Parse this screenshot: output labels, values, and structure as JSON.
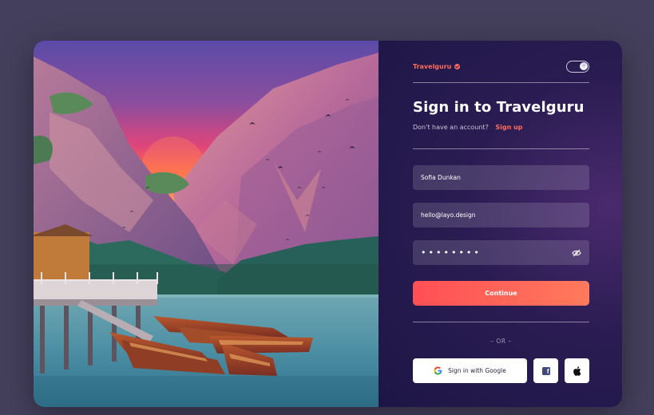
{
  "brand": {
    "name": "Travelguru",
    "badge_icon": "verified-badge-icon",
    "color": "#ff6b5a"
  },
  "theme_toggle": {
    "icon": "sun-icon",
    "knob_glyph": "☼"
  },
  "heading": {
    "title": "Sign in to Travelguru",
    "subtitle": "Don't have an account?",
    "signup_link": "Sign up"
  },
  "form": {
    "name_value": "Sofia Dunkan",
    "email_value": "hello@layo.design",
    "password_masked": "••••••••",
    "password_toggle_icon": "eye-slash-icon",
    "continue_label": "Continue",
    "accent_gradient": [
      "#ff4f55",
      "#ff7a5c"
    ]
  },
  "divider": {
    "or_text": "– OR –"
  },
  "social": {
    "google_label": "Sign in with Google",
    "google_icon": "google-g-icon",
    "facebook_icon": "facebook-icon",
    "facebook_glyph": "f",
    "apple_icon": "apple-icon"
  },
  "colors": {
    "page_bg": "#443f5c",
    "panel_bg": "#1d1645",
    "field_bg": "rgba(255,255,255,0.14)"
  }
}
